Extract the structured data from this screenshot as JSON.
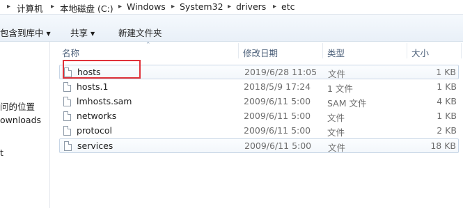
{
  "address": {
    "segments": [
      "计算机",
      "本地磁盘 (C:)",
      "Windows",
      "System32",
      "drivers",
      "etc"
    ],
    "separator": "▸"
  },
  "toolbar": {
    "include_in_library": "包含到库中",
    "share": "共享",
    "new_folder": "新建文件夹"
  },
  "nav": {
    "items": [
      "问的位置",
      "ownloads",
      "t"
    ]
  },
  "columns": {
    "name": "名称",
    "modified": "修改日期",
    "type": "类型",
    "size": "大小"
  },
  "files": [
    {
      "name": "hosts",
      "date": "2019/6/28 11:05",
      "type": "文件",
      "size": "1 KB"
    },
    {
      "name": "hosts.1",
      "date": "2018/5/9 17:24",
      "type": "1 文件",
      "size": "1 KB"
    },
    {
      "name": "lmhosts.sam",
      "date": "2009/6/11 5:00",
      "type": "SAM 文件",
      "size": "4 KB"
    },
    {
      "name": "networks",
      "date": "2009/6/11 5:00",
      "type": "文件",
      "size": "1 KB"
    },
    {
      "name": "protocol",
      "date": "2009/6/11 5:00",
      "type": "文件",
      "size": "2 KB"
    },
    {
      "name": "services",
      "date": "2009/6/11 5:00",
      "type": "文件",
      "size": "18 KB"
    }
  ],
  "colors": {
    "highlight": "#e0323a",
    "header_text": "#4c607a"
  }
}
